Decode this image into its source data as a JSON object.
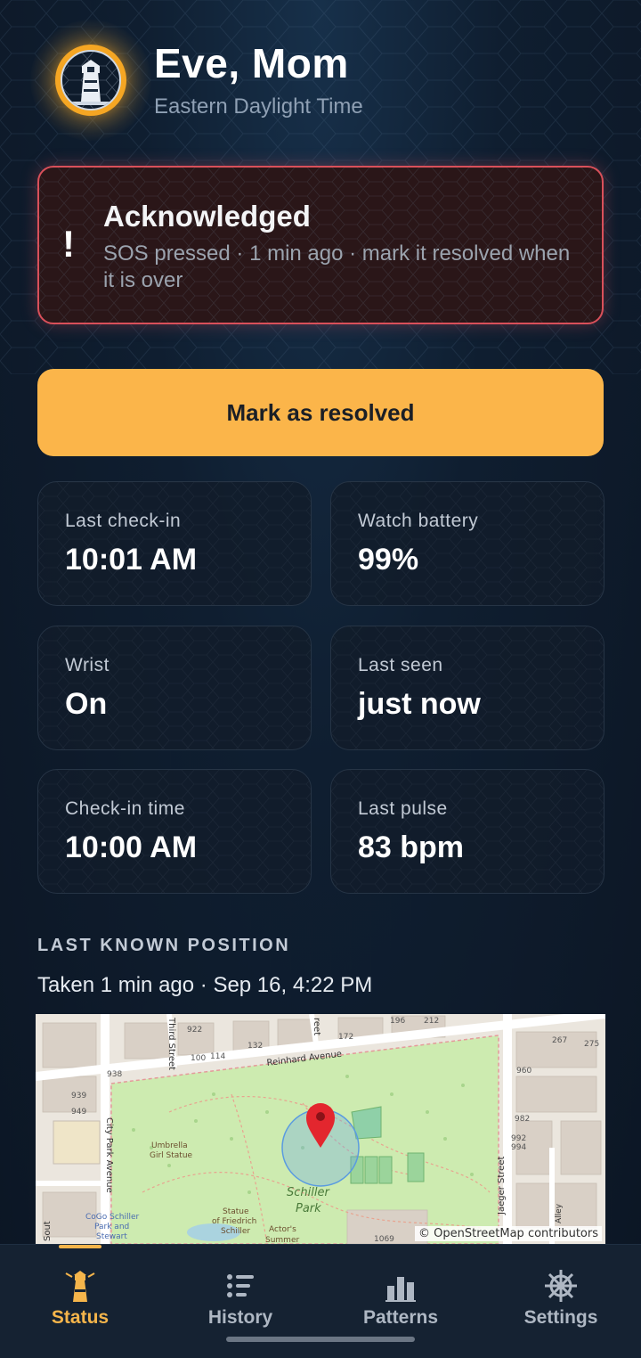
{
  "header": {
    "name": "Eve, Mom",
    "timezone": "Eastern Daylight Time"
  },
  "alert": {
    "icon": "!",
    "title": "Acknowledged",
    "subtitle": "SOS pressed · 1 min ago · mark it resolved when it is over",
    "accent_color": "#d9505a"
  },
  "resolve_button": {
    "label": "Mark as resolved",
    "color": "#fbb54a"
  },
  "stats": [
    {
      "label": "Last check-in",
      "value": "10:01 AM"
    },
    {
      "label": "Watch battery",
      "value": "99%"
    },
    {
      "label": "Wrist",
      "value": "On"
    },
    {
      "label": "Last seen",
      "value": "just now"
    },
    {
      "label": "Check-in time",
      "value": "10:00 AM"
    },
    {
      "label": "Last pulse",
      "value": "83 bpm"
    }
  ],
  "position": {
    "title": "LAST KNOWN POSITION",
    "subtitle": "Taken 1 min ago · Sep 16, 4:22 PM"
  },
  "map": {
    "attribution": "© OpenStreetMap contributors",
    "labels": {
      "reinhard": "Reinhard Avenue",
      "third": "Third Street",
      "city_park": "City Park Avenue",
      "jaeger": "Jaeger Street",
      "alley": "Alley",
      "schiller_park_1": "Schiller",
      "schiller_park_2": "Park",
      "umbrella_1": "Umbrella",
      "umbrella_2": "Girl Statue",
      "statue_1": "Statue",
      "statue_2": "of Friedrich",
      "statue_3": "Schiller",
      "actors_1": "Actor's",
      "actors_2": "Summer",
      "cogo_1": "CoGo Schiller",
      "cogo_2": "Park and",
      "cogo_3": "Stewart",
      "street_cut": "reet",
      "south": "Sout",
      "n922": "922",
      "n100": "100",
      "n114": "114",
      "n132": "132",
      "n172": "172",
      "n196": "196",
      "n212": "212",
      "n267": "267",
      "n275": "275",
      "n938": "938",
      "n939": "939",
      "n949": "949",
      "n960": "960",
      "n982": "982",
      "n992": "992",
      "n994": "994",
      "n1069": "1069"
    }
  },
  "nav": {
    "items": [
      {
        "label": "Status",
        "icon": "lighthouse-icon",
        "active": true
      },
      {
        "label": "History",
        "icon": "list-icon",
        "active": false
      },
      {
        "label": "Patterns",
        "icon": "bar-chart-icon",
        "active": false
      },
      {
        "label": "Settings",
        "icon": "ship-wheel-icon",
        "active": false
      }
    ],
    "active_color": "#f5b54b"
  }
}
